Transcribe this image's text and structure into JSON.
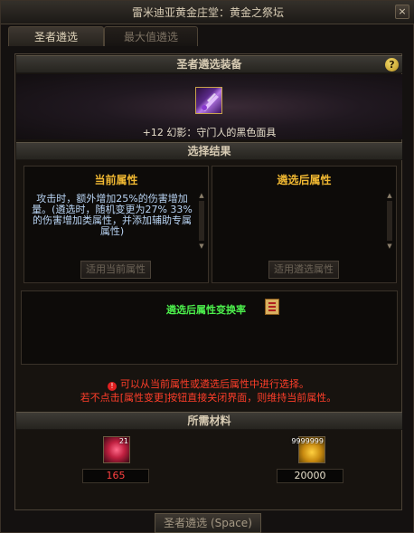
{
  "window": {
    "title": "雷米迪亚黄金庄堂：黄金之祭坛",
    "close_label": "×"
  },
  "tabs": [
    {
      "label": "圣者遴选",
      "active": true
    },
    {
      "label": "最大值遴选",
      "active": false
    }
  ],
  "equipment": {
    "header": "圣者遴选装备",
    "help_label": "?",
    "item_name": "+12 幻影：守门人的黑色面具"
  },
  "selection": {
    "header": "选择结果",
    "current": {
      "title": "当前属性",
      "description": "攻击时，额外增加25%的伤害增加量。(遴选时，随机变更为27% 33%的伤害增加类属性，并添加辅助专属属性)",
      "button": "适用当前属性"
    },
    "after": {
      "title": "遴选后属性",
      "description": "",
      "button": "适用遴选属性"
    }
  },
  "rate": {
    "label": "遴选后属性变换率"
  },
  "warnings": {
    "line1": "可以从当前属性或遴选后属性中进行选择。",
    "line2": "若不点击[属性变更]按钮直接关闭界面，则维持当前属性。"
  },
  "materials": {
    "header": "所需材料",
    "items": [
      {
        "count_badge": "21",
        "value": "165",
        "value_color": "#ff4040"
      },
      {
        "count_badge": "9999999",
        "value": "20000",
        "value_color": "#e8e0cc"
      }
    ]
  },
  "footer": {
    "button": "圣者遴选 (Space)"
  },
  "colors": {
    "accent_gold": "#f0b832",
    "rate_green": "#4cf04c",
    "warning_red": "#ff3e2a",
    "text_blue": "#b9d4f4"
  },
  "icons": [
    "close-icon",
    "help-icon",
    "mask-item-icon",
    "rate-info-icon",
    "warning-icon",
    "gem-material-icon",
    "gold-material-icon"
  ]
}
